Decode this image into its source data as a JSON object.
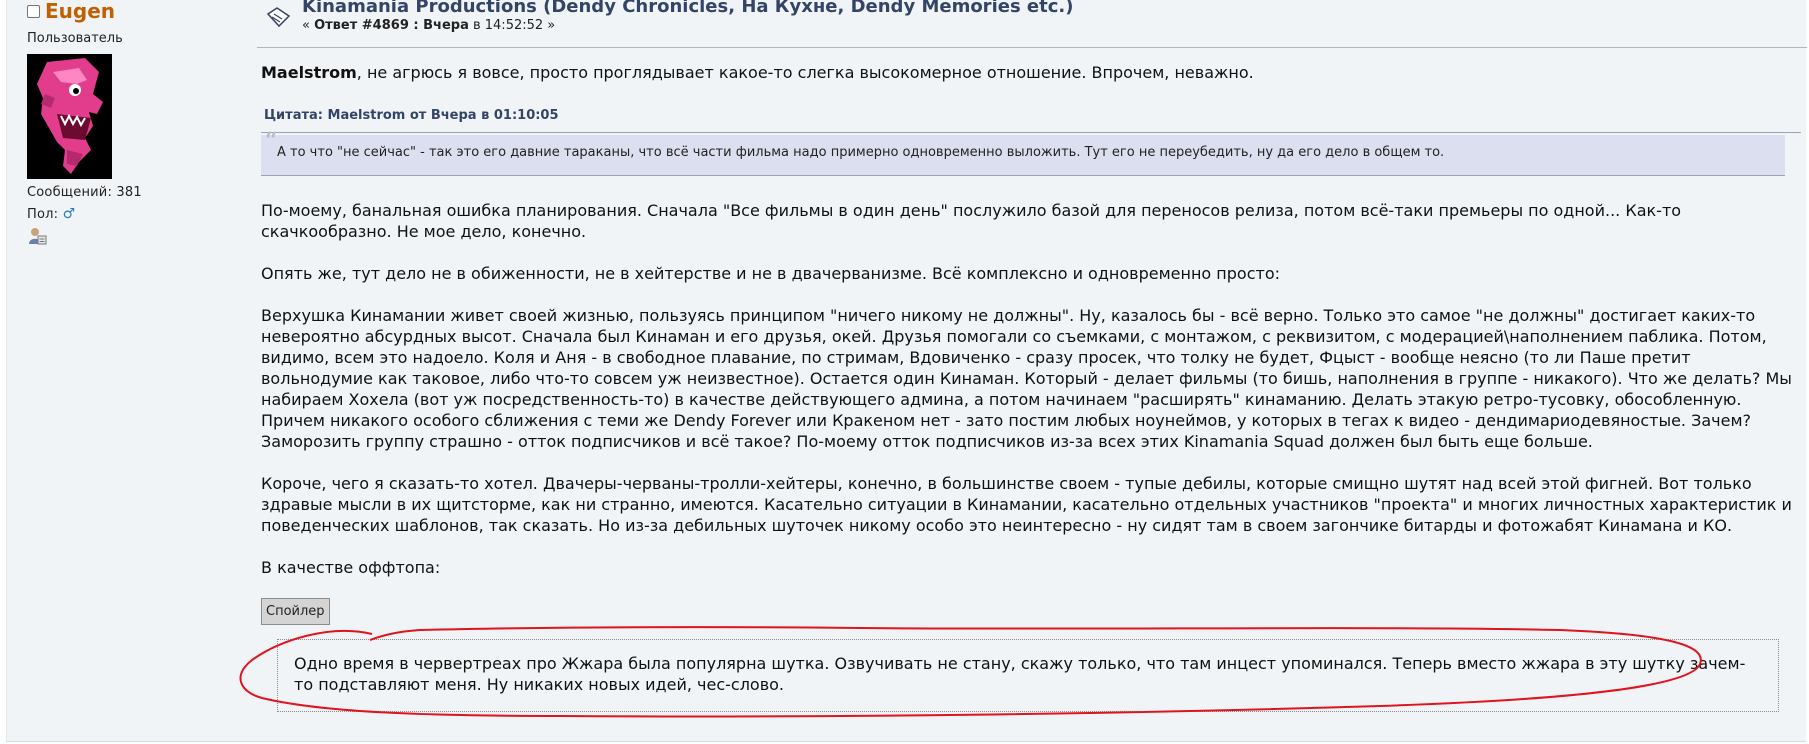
{
  "poster": {
    "username": "Eugen",
    "member_group": "Пользователь",
    "posts_label": "Сообщений:",
    "posts_count": "381",
    "gender_label": "Пол:",
    "gender_icon": "male-icon"
  },
  "header": {
    "topic_title": "Kinamania Productions (Dendy Chronicles, На Кухне, Dendy Memories etc.)",
    "reply_prefix": "« ",
    "reply_label": "Ответ #4869 : Вчера",
    "time_text": " в 14:52:52 »"
  },
  "post": {
    "greeting_name": "Maelstrom",
    "greeting_text": ", не агрюсь я вовсе, просто проглядывает какое-то слегка высокомерное отношение. Впрочем, неважно.",
    "quote_header": "Цитата: Maelstrom от Вчера в 01:10:05",
    "quote_text": "А то что \"не сейчас\" - так это его давние тараканы, что всё части фильма надо примерно одновременно выложить. Тут его не переубедить, ну да его дело в общем то.",
    "paragraphs": [
      "По-моему, банальная ошибка планирования. Сначала \"Все фильмы в один день\" послужило базой для переносов релиза, потом всё-таки премьеры по одной... Как-то скачкообразно. Не мое дело, конечно.",
      "Опять же, тут дело не в обиженности, не в хейтерстве и не в двачерванизме. Всё комплексно и одновременно просто:",
      "Верхушка Кинамании живет своей жизнью, пользуясь принципом \"ничего никому не должны\". Ну, казалось бы - всё верно. Только это самое \"не должны\" достигает каких-то невероятно абсурдных высот. Сначала был Кинаман и его друзья, окей. Друзья помогали со съемками, с монтажом, с реквизитом, с модерацией\\наполнением паблика. Потом, видимо, всем это надоело. Коля и Аня - в свободное плавание, по стримам, Вдовиченко - сразу просек, что толку не будет, Фцыст - вообще неясно (то ли Паше претит вольнодумие как таковое, либо что-то совсем уж неизвестное). Остается один Кинаман. Который - делает фильмы (то бишь, наполнения в группе - никакого). Что же делать? Мы набираем Хохела (вот уж посредственность-то) в качестве действующего админа, а потом начинаем \"расширять\" кинаманию. Делать этакую ретро-тусовку, обособленную. Причем никакого особого сближения с теми же Dendy Forever или Кракеном нет - зато постим любых ноунеймов, у которых в тегах к видео - дендимариодевяностые. Зачем? Заморозить группу страшно - отток подписчиков и всё такое? По-моему отток подписчиков из-за всех этих Kinamania Squad должен был быть еще больше.",
      "Короче, чего я сказать-то хотел. Двачеры-черваны-тролли-хейтеры, конечно, в большинстве своем - тупые дебилы, которые смищно шутят над всей этой фигней. Вот только здравые мысли в их щитсторме, как ни странно, имеются. Касательно ситуации в Кинамании, касательно отдельных участников \"проекта\" и многих личностных характеристик и поведенческих шаблонов, так сказать. Но из-за дебильных шуточек никому особо это неинтересно - ну сидят там в своем загончике битарды и фотожабят Кинамана и КО.",
      "В качестве оффтопа:"
    ],
    "spoiler_button": "Спойлер",
    "spoiler_text": "Одно время в червертреах про Жжара была популярна шутка. Озвучивать не стану, скажу только, что там инцест упоминался. Теперь вместо жжара в эту шутку зачем-то подставляют меня. Ну никаких новых идей, чес-слово."
  },
  "colors": {
    "background": "#f0f4f7",
    "username": "#c06002",
    "title": "#334466",
    "quote_bg": "#dcdff0",
    "scribble": "#e0141e"
  }
}
